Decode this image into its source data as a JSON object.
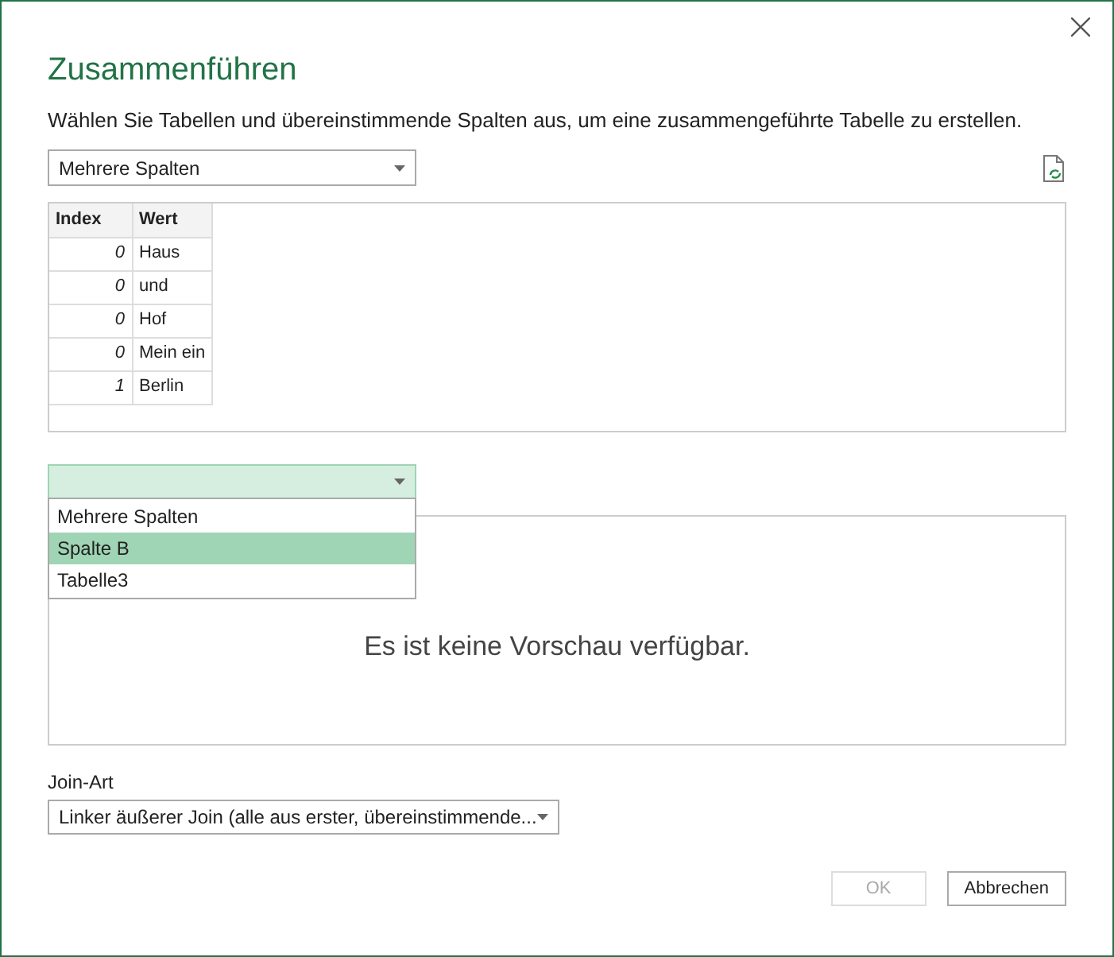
{
  "dialog": {
    "title": "Zusammenführen",
    "description": "Wählen Sie Tabellen und übereinstimmende Spalten aus, um eine zusammengeführte Tabelle zu erstellen."
  },
  "first_table": {
    "value": "Mehrere Spalten",
    "columns": [
      "Index",
      "Wert"
    ],
    "rows": [
      [
        "0",
        "Haus"
      ],
      [
        "0",
        "und"
      ],
      [
        "0",
        "Hof"
      ],
      [
        "0",
        "Mein ein"
      ],
      [
        "1",
        "Berlin"
      ]
    ]
  },
  "second_table": {
    "expanded": true,
    "options": [
      {
        "label": "Mehrere Spalten",
        "selected": false
      },
      {
        "label": "Spalte B",
        "selected": true
      },
      {
        "label": "Tabelle3",
        "selected": false
      }
    ],
    "preview_message": "Es ist keine Vorschau verfügbar."
  },
  "join": {
    "label": "Join-Art",
    "value": "Linker äußerer Join (alle aus erster, übereinstimmende..."
  },
  "buttons": [
    {
      "label": "OK",
      "disabled": true
    },
    {
      "label": "Abbrechen",
      "disabled": false
    }
  ]
}
